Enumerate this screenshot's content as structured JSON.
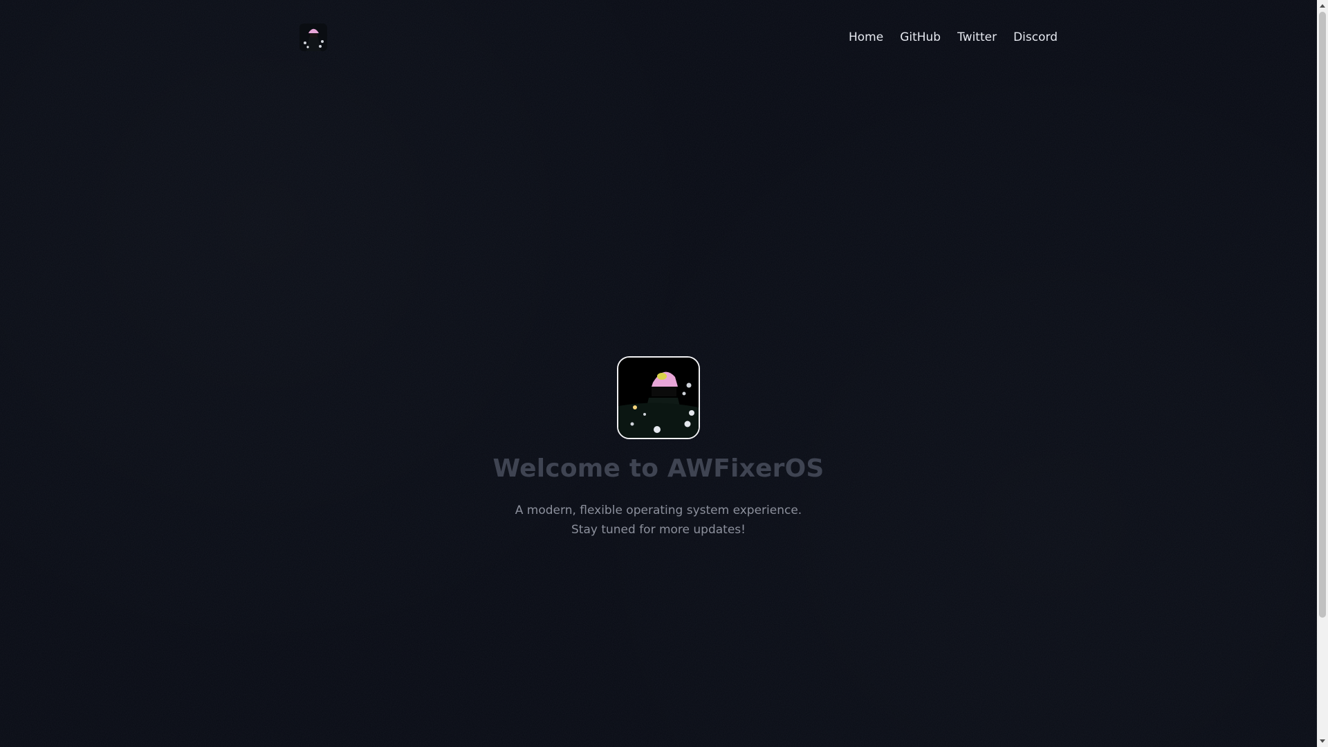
{
  "header": {
    "logo_icon": "avatar-pink-cap-icon",
    "nav": [
      {
        "label": "Home"
      },
      {
        "label": "GitHub"
      },
      {
        "label": "Twitter"
      },
      {
        "label": "Discord"
      }
    ]
  },
  "hero": {
    "image_icon": "avatar-pink-cap-icon",
    "title": "Welcome to AWFixerOS",
    "subtitle_line1": "A modern, flexible operating system experience.",
    "subtitle_line2": "Stay tuned for more updates!"
  },
  "colors": {
    "background": "#080b14",
    "title": "#3f4452",
    "subtitle": "#8c909c",
    "nav_text": "#e6e9f0",
    "cap_pink": "#e8a6d8"
  },
  "scrollbar": {
    "up_icon": "scroll-up-arrow-icon",
    "down_icon": "scroll-down-arrow-icon"
  }
}
